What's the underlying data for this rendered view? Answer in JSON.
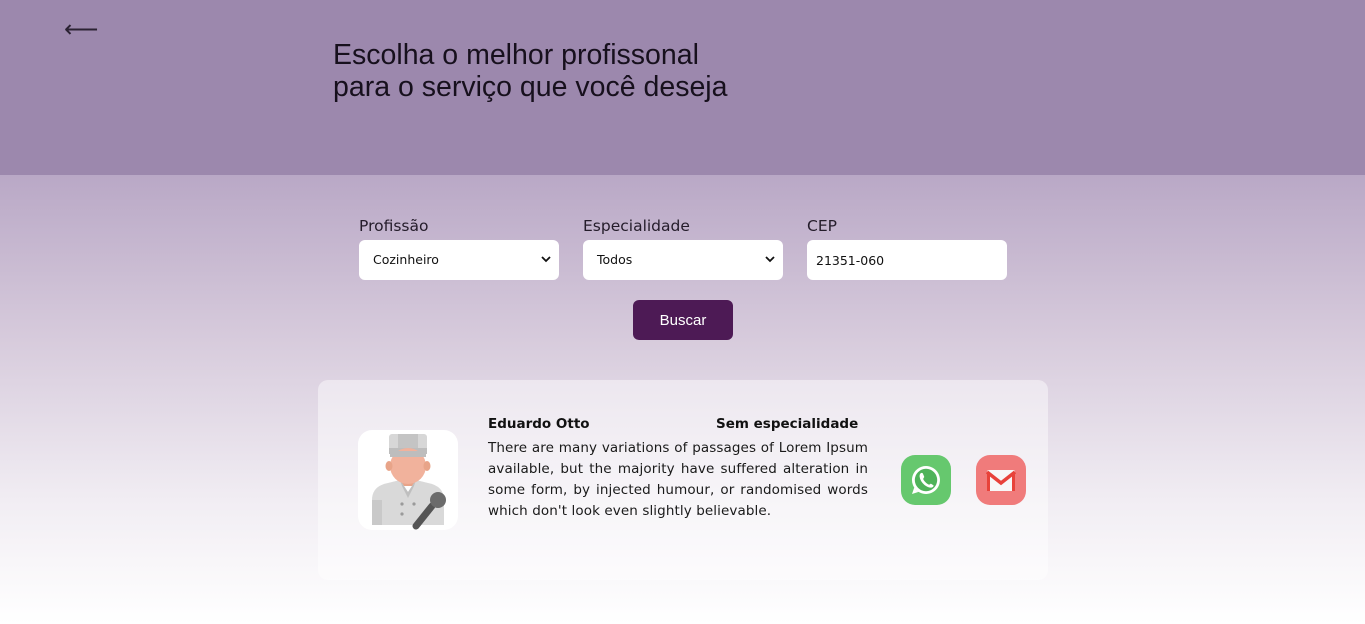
{
  "header": {
    "back_icon": "arrow-left-icon",
    "back_glyph": "⟵",
    "title": "Escolha o melhor profissonal para o serviço que você deseja"
  },
  "filters": {
    "profissao": {
      "label": "Profissão",
      "value": "Cozinheiro"
    },
    "especialidade": {
      "label": "Especialidade",
      "value": "Todos"
    },
    "cep": {
      "label": "CEP",
      "value": "21351-060"
    },
    "search_label": "Buscar"
  },
  "result": {
    "name": "Eduardo Otto",
    "specialty": "Sem especialidade",
    "description": "There are many variations of passages of Lorem Ipsum available, but the majority have suffered alteration in some form, by injected humour, or randomised words which don't look even slightly believable.",
    "avatar_icon": "chef-avatar-icon",
    "whatsapp_icon": "whatsapp-icon",
    "email_icon": "gmail-icon"
  },
  "colors": {
    "header_bg": "#9c88ad",
    "button_bg": "#4d1a55",
    "whatsapp": "#66c86e",
    "email": "#f07b7b"
  }
}
